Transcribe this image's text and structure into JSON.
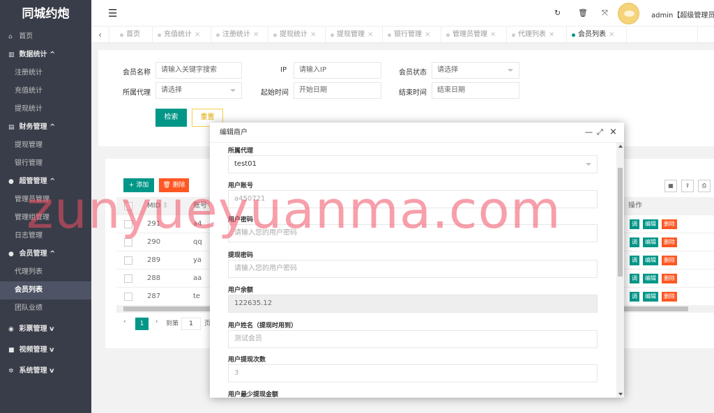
{
  "app": {
    "title": "同城约炮"
  },
  "sidebar": {
    "home": "首页",
    "group1": "数据统计 ^",
    "g1_items": [
      "注册统计",
      "充值统计",
      "提现统计"
    ],
    "group2": "财务管理 ^",
    "g2_items": [
      "提现管理",
      "银行管理"
    ],
    "group3": "超管管理 ^",
    "g3_items": [
      "管理员管理",
      "管理组管理",
      "日志管理"
    ],
    "group4": "会员管理 ^",
    "g4_items": [
      "代理列表",
      "会员列表",
      "团队业绩"
    ],
    "group5": "彩票管理 v",
    "group6": "视频管理 v",
    "group7": "系统管理 v"
  },
  "header": {
    "user": "admin【超级管理员】"
  },
  "tabs": [
    "首页",
    "充值统计",
    "注册统计",
    "提现统计",
    "提现管理",
    "银行管理",
    "管理员管理",
    "代理列表",
    "会员列表"
  ],
  "filters": {
    "member_name_label": "会员名称",
    "member_name_ph": "请输入关键字搜索",
    "ip_label": "IP",
    "ip_ph": "请输入IP",
    "status_label": "会员状态",
    "status_ph": "请选择",
    "agent_label": "所属代理",
    "agent_ph": "请选择",
    "start_label": "起始时间",
    "start_ph": "开始日期",
    "end_label": "结束时间",
    "end_ph": "结束日期",
    "search": "检索",
    "reset": "重置"
  },
  "table": {
    "add": "添加",
    "delete": "删除",
    "columns": {
      "mid": "MID",
      "account": "账号",
      "ops": "操作"
    },
    "rows": [
      {
        "mid": "291",
        "account": "a4"
      },
      {
        "mid": "290",
        "account": "qq"
      },
      {
        "mid": "289",
        "account": "ya"
      },
      {
        "mid": "288",
        "account": "aa"
      },
      {
        "mid": "287",
        "account": "te"
      }
    ],
    "op_labels": {
      "view": "调",
      "edit": "编辑",
      "del": "删除"
    },
    "pager": {
      "page": "1",
      "goto": "到第",
      "input": "1",
      "page_unit": "页"
    }
  },
  "modal": {
    "title": "编辑商户",
    "agent_label": "所属代理",
    "agent_value": "test01",
    "account_label": "用户账号",
    "account_value": "a450721",
    "password_label": "用户密码",
    "password_ph": "请输入您的用户密码",
    "withdraw_pwd_label": "提现密码",
    "withdraw_pwd_ph": "请输入您的用户密码",
    "balance_label": "用户余额",
    "balance_value": "122635.12",
    "name_label": "用户姓名（提现时用到）",
    "name_value": "测试会员",
    "withdraw_count_label": "用户提现次数",
    "withdraw_count_value": "3",
    "min_withdraw_label": "用户最少提现金额"
  },
  "watermark": "zunyueyuanma.com"
}
